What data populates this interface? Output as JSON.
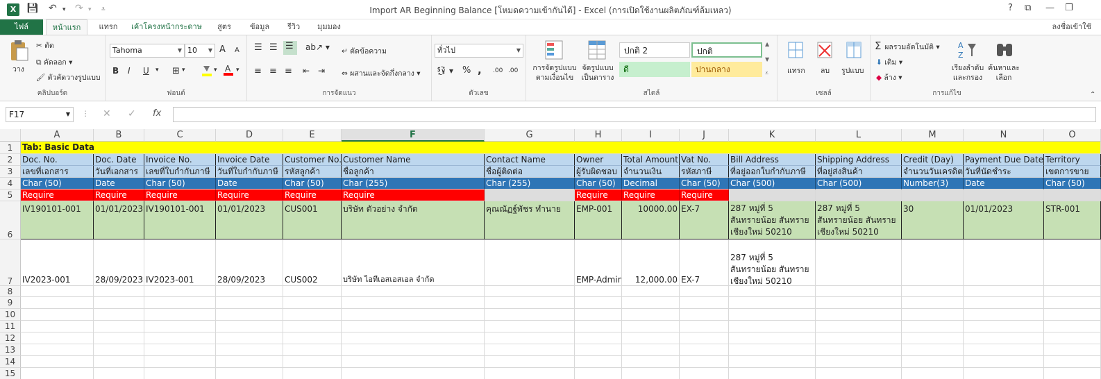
{
  "window": {
    "title": "Import AR Beginning Balance  [โหมดความเข้ากันได้] - Excel (การเปิดใช้งานผลิตภัณฑ์ล้มเหลว)",
    "help": "?",
    "restore": "⧉",
    "minimize": "—",
    "maximize": "❐"
  },
  "tabs": {
    "file": "ไฟล์",
    "items": [
      "หน้าแรก",
      "แทรก",
      "เค้าโครงหน้ากระดาษ",
      "สูตร",
      "ข้อมูล",
      "รีวิว",
      "มุมมอง"
    ],
    "signin": "ลงชื่อเข้าใช้"
  },
  "ribbon": {
    "clipboard": {
      "paste": "วาง",
      "cut": "ตัด",
      "copy": "คัดลอก",
      "format_painter": "ตัวคัดวางรูปแบบ",
      "label": "คลิปบอร์ด"
    },
    "font": {
      "name": "Tahoma",
      "size": "10",
      "bold": "B",
      "italic": "I",
      "underline": "U",
      "grow": "A",
      "shrink": "A",
      "label": "ฟอนต์"
    },
    "alignment": {
      "wrap": "ตัดข้อความ",
      "merge": "ผสานและจัดกึ่งกลาง",
      "label": "การจัดแนว"
    },
    "number": {
      "format": "ทั่วไป",
      "percent": "%",
      "comma": ",",
      "inc_dec": ".00",
      "dec_dec": ".00",
      "label": "ตัวเลข"
    },
    "styles": {
      "conditional": "การจัดรูปแบบ ตามเงื่อนไข",
      "format_table": "จัดรูปแบบ เป็นตาราง",
      "normal2": "ปกติ 2",
      "normal": "ปกติ",
      "good": "ดี",
      "neutral": "ปานกลาง",
      "label": "สไตล์"
    },
    "cells": {
      "insert": "แทรก",
      "delete": "ลบ",
      "format": "รูปแบบ",
      "label": "เซลล์"
    },
    "editing": {
      "autosum": "ผลรวมอัตโนมัติ",
      "fill": "เติม",
      "clear": "ล้าง",
      "sort": "เรียงลำดับ และกรอง",
      "find": "ค้นหาและ เลือก",
      "label": "การแก้ไข"
    }
  },
  "formula_bar": {
    "namebox": "F17",
    "fx": "fx",
    "value": ""
  },
  "sheet": {
    "columns": [
      "A",
      "B",
      "C",
      "D",
      "E",
      "F",
      "G",
      "H",
      "I",
      "J",
      "K",
      "L",
      "M",
      "N",
      "O"
    ],
    "selected_column": "F",
    "row_numbers": [
      "1",
      "2",
      "3",
      "4",
      "5",
      "6",
      "7",
      "8",
      "9",
      "10",
      "11",
      "12",
      "13",
      "14",
      "15"
    ],
    "r1": "Tab: Basic Data",
    "r2": [
      "Doc. No.",
      "Doc. Date",
      "Invoice No.",
      "Invoice Date",
      "Customer No.",
      "Customer Name",
      "Contact Name",
      "Owner",
      "Total Amount",
      "Vat No.",
      "Bill Address",
      "Shipping Address",
      "Credit (Day)",
      "Payment Due Date",
      "Territory"
    ],
    "r3": [
      "เลขที่เอกสาร",
      "วันที่เอกสาร",
      "เลขที่ใบกำกับภาษี",
      "วันที่ใบกำกับภาษี",
      "รหัสลูกค้า",
      "ชื่อลูกค้า",
      "ชื่อผู้ติดต่อ",
      "ผู้รับผิดชอบ",
      "จำนวนเงิน",
      "รหัสภาษี",
      "ที่อยู่ออกใบกำกับภาษี",
      "ที่อยู่ส่งสินค้า",
      "จำนวนวันเครดิต",
      "วันที่นัดชำระ",
      "เขตการขาย"
    ],
    "r4": [
      "Char (50)",
      "Date",
      "Char (50)",
      "Date",
      "Char (50)",
      "Char (255)",
      "Char (255)",
      "Char (50)",
      "Decimal",
      "Char (50)",
      "Char (500)",
      "Char (500)",
      "Number(3)",
      "Date",
      "Char (50)"
    ],
    "r5": [
      "Require",
      "Require",
      "Require",
      "Require",
      "Require",
      "Require",
      "",
      "Require",
      "Require",
      "Require",
      "",
      "",
      "",
      "",
      ""
    ],
    "r6": [
      "IV190101-001",
      "01/01/2023",
      "IV190101-001",
      "01/01/2023",
      "CUS001",
      "บริษัท ตัวอย่าง จำกัด",
      "คุณณัฏฐ์พัชร ทำนาย",
      "EMP-001",
      "10000.00",
      "EX-7",
      "287 หมู่ที่ 5\nสันทรายน้อย สันทราย\nเชียงใหม่ 50210",
      "287 หมู่ที่ 5\nสันทรายน้อย สันทราย\nเชียงใหม่ 50210",
      "30",
      "01/01/2023",
      "STR-001"
    ],
    "r7": [
      "IV2023-001",
      "28/09/2023",
      "IV2023-001",
      "28/09/2023",
      "CUS002",
      "บริษัท ไอทีเอสเอสเอล จำกัด",
      "",
      "EMP-Admin",
      "12,000.00",
      "EX-7",
      "287 หมู่ที่ 5\nสันทรายน้อย สันทราย\nเชียงใหม่ 50210",
      "",
      "",
      "",
      ""
    ]
  },
  "colors": {
    "yellow": "#ffff00",
    "header_blue": "#bdd7ee",
    "type_blue": "#2e75b6",
    "require_red": "#ff0000",
    "data_green": "#c6e0b4",
    "excel_green": "#217346"
  }
}
